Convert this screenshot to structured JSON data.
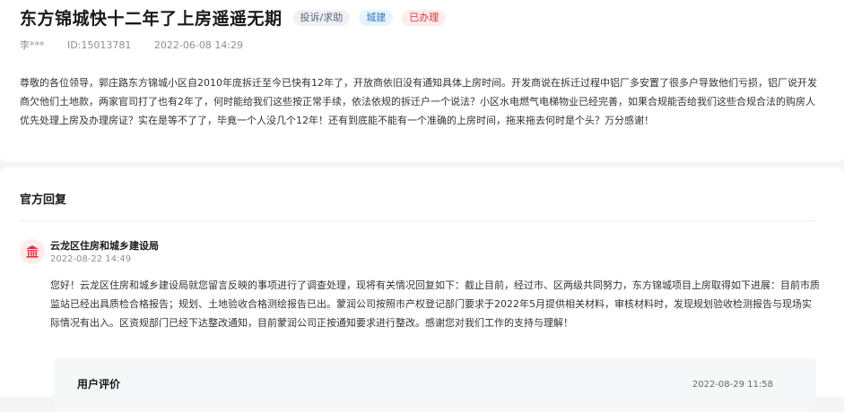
{
  "post": {
    "title": "东方锦城快十二年了上房遥遥无期",
    "tags": {
      "type": "投诉/求助",
      "department": "城建",
      "status": "已办理"
    },
    "author": "李***",
    "id_label": "ID:15013781",
    "date": "2022-06-08 14:29",
    "content": "尊敬的各位领导，郭庄路东方锦城小区自2010年庞拆迁至今已快有12年了，开放商依旧没有通知具体上房时间。开发商说在拆迁过程中铝厂多安置了很多户导致他们亏损，铝厂说开发商欠他们土地款，两家官司打了也有2年了，何时能给我们这些按正常手续，依法依规的拆迁户一个说法？小区水电燃气电梯物业已经完善，如果合规能否给我们这些合规合法的购房人优先处理上房及办理房证？实在是等不了了，毕竟一个人没几个12年！还有到底能不能有一个准确的上房时间，拖来拖去何时是个头？万分感谢！"
  },
  "official_reply": {
    "section_title": "官方回复",
    "department": "云龙区住房和城乡建设局",
    "time": "2022-08-22 14:49",
    "content": "您好！云龙区住房和城乡建设局就您留言反映的事项进行了调查处理，现将有关情况回复如下：截止目前，经过市、区两级共同努力，东方锦城项目上房取得如下进展：目前市质监站已经出具质检合格报告；规划、土地验收合格测绘报告已出。蒙润公司按照市产权登记部门要求于2022年5月提供相关材料，审核材料时，发现规划验收检测报告与现场实际情况有出入。区资规部门已经下达整改通知，目前蒙润公司正按通知要求进行整改。感谢您对我们工作的支持与理解！",
    "icon": "government-building-icon",
    "accent_color": "#d9363e"
  },
  "user_evaluation": {
    "title": "用户评价",
    "time": "2022-08-29 11:58"
  }
}
